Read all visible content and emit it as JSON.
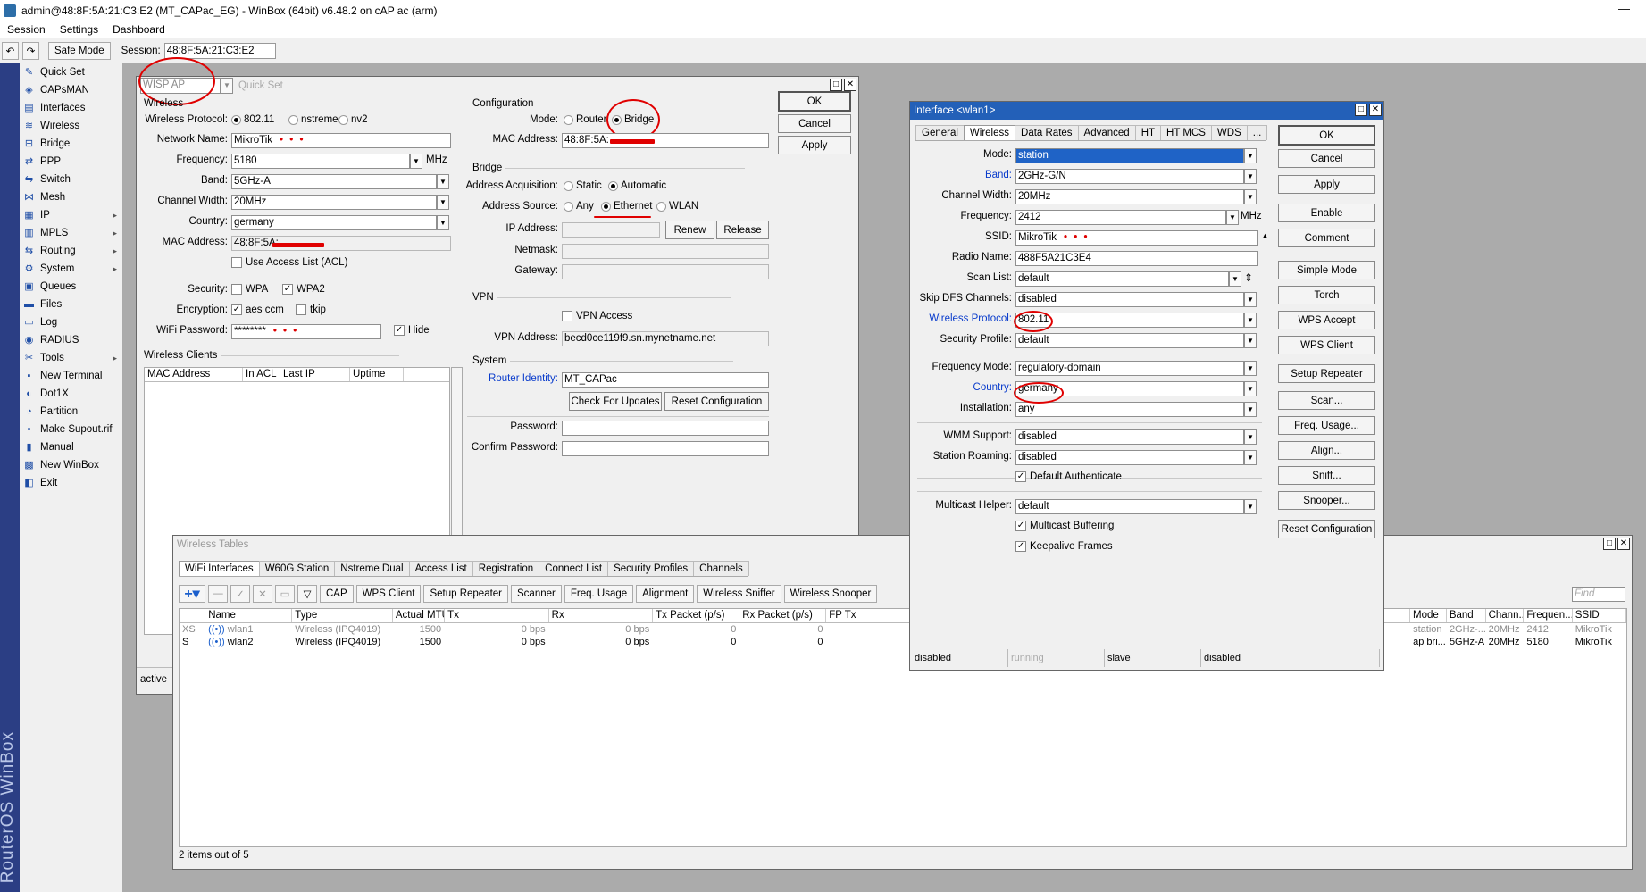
{
  "app": {
    "title": "admin@48:8F:5A:21:C3:E2 (MT_CAPac_EG) - WinBox (64bit) v6.48.2 on cAP ac (arm)",
    "minimize": "—",
    "vertical_brand": "RouterOS WinBox"
  },
  "menu": {
    "session": "Session",
    "settings": "Settings",
    "dashboard": "Dashboard"
  },
  "toolbar": {
    "undo": "↶",
    "redo": "↷",
    "safe_mode": "Safe Mode",
    "session_label": "Session:",
    "session_value": "48:8F:5A:21:C3:E2"
  },
  "sidebar": {
    "items": [
      {
        "label": "Quick Set",
        "icon": "quickset-icon"
      },
      {
        "label": "CAPsMAN",
        "icon": "capsman-icon"
      },
      {
        "label": "Interfaces",
        "icon": "interfaces-icon"
      },
      {
        "label": "Wireless",
        "icon": "wireless-icon"
      },
      {
        "label": "Bridge",
        "icon": "bridge-icon"
      },
      {
        "label": "PPP",
        "icon": "ppp-icon"
      },
      {
        "label": "Switch",
        "icon": "switch-icon"
      },
      {
        "label": "Mesh",
        "icon": "mesh-icon"
      },
      {
        "label": "IP",
        "icon": "ip-icon",
        "arrow": "▸"
      },
      {
        "label": "MPLS",
        "icon": "mpls-icon",
        "arrow": "▸"
      },
      {
        "label": "Routing",
        "icon": "routing-icon",
        "arrow": "▸"
      },
      {
        "label": "System",
        "icon": "system-icon",
        "arrow": "▸"
      },
      {
        "label": "Queues",
        "icon": "queues-icon"
      },
      {
        "label": "Files",
        "icon": "files-icon"
      },
      {
        "label": "Log",
        "icon": "log-icon"
      },
      {
        "label": "RADIUS",
        "icon": "radius-icon"
      },
      {
        "label": "Tools",
        "icon": "tools-icon",
        "arrow": "▸"
      },
      {
        "label": "New Terminal",
        "icon": "terminal-icon"
      },
      {
        "label": "Dot1X",
        "icon": "dot1x-icon"
      },
      {
        "label": "Partition",
        "icon": "partition-icon"
      },
      {
        "label": "Make Supout.rif",
        "icon": "supout-icon"
      },
      {
        "label": "Manual",
        "icon": "manual-icon"
      },
      {
        "label": "New WinBox",
        "icon": "winbox-icon"
      },
      {
        "label": "Exit",
        "icon": "exit-icon"
      }
    ]
  },
  "quickset": {
    "mode_select": "WISP AP",
    "title": "Quick Set",
    "ok": "OK",
    "cancel": "Cancel",
    "apply": "Apply",
    "wireless_section": "Wireless",
    "wireless_protocol_label": "Wireless Protocol:",
    "proto_80211": "802.11",
    "proto_nstreme": "nstreme",
    "proto_nv2": "nv2",
    "network_name_label": "Network Name:",
    "network_name": "MikroTik",
    "redacted_dots": "• • •",
    "frequency_label": "Frequency:",
    "frequency": "5180",
    "mhz": "MHz",
    "band_label": "Band:",
    "band": "5GHz-A",
    "channel_width_label": "Channel Width:",
    "channel_width": "20MHz",
    "country_label": "Country:",
    "country": "germany",
    "mac_label": "MAC Address:",
    "mac": "48:8F:5A:",
    "acl": "Use Access List (ACL)",
    "security_label": "Security:",
    "wpa": "WPA",
    "wpa2": "WPA2",
    "encryption_label": "Encryption:",
    "aes": "aes ccm",
    "tkip": "tkip",
    "wifi_password_label": "WiFi Password:",
    "wifi_password": "********",
    "hide": "Hide",
    "wireless_clients_section": "Wireless Clients",
    "clients_cols": [
      "MAC Address",
      "In ACL",
      "Last IP",
      "Uptime"
    ],
    "config_section": "Configuration",
    "mode_label": "Mode:",
    "mode_router": "Router",
    "mode_bridge": "Bridge",
    "cfg_mac_label": "MAC Address:",
    "cfg_mac": "48:8F:5A:",
    "bridge_section": "Bridge",
    "addr_acq_label": "Address Acquisition:",
    "static": "Static",
    "automatic": "Automatic",
    "addr_source_label": "Address Source:",
    "any": "Any",
    "ethernet": "Ethernet",
    "wlan": "WLAN",
    "ip_address_label": "IP Address:",
    "renew": "Renew",
    "release": "Release",
    "netmask_label": "Netmask:",
    "gateway_label": "Gateway:",
    "vpn_section": "VPN",
    "vpn_access": "VPN Access",
    "vpn_address_label": "VPN Address:",
    "vpn_address": "becd0ce119f9.sn.mynetname.net",
    "system_section": "System",
    "router_identity_label": "Router Identity:",
    "router_identity": "MT_CAPac",
    "check_updates": "Check For Updates",
    "reset_config": "Reset Configuration",
    "password_label": "Password:",
    "confirm_password_label": "Confirm Password:",
    "status": "active"
  },
  "wtables": {
    "title": "Wireless Tables",
    "tabs": [
      "WiFi Interfaces",
      "W60G Station",
      "Nstreme Dual",
      "Access List",
      "Registration",
      "Connect List",
      "Security Profiles",
      "Channels"
    ],
    "tool_buttons": [
      "CAP",
      "WPS Client",
      "Setup Repeater",
      "Scanner",
      "Freq. Usage",
      "Alignment",
      "Wireless Sniffer",
      "Wireless Snooper"
    ],
    "find_placeholder": "Find",
    "columns": [
      "Name",
      "Type",
      "Actual MTU",
      "Tx",
      "Rx",
      "Tx Packet (p/s)",
      "Rx Packet (p/s)",
      "FP Tx"
    ],
    "rows": [
      {
        "flag": "XS",
        "name": "wlan1",
        "type": "Wireless (IPQ4019)",
        "mtu": "1500",
        "tx": "0 bps",
        "rx": "0 bps",
        "txp": "0",
        "rxp": "0"
      },
      {
        "flag": "S",
        "name": "wlan2",
        "type": "Wireless (IPQ4019)",
        "mtu": "1500",
        "tx": "0 bps",
        "rx": "0 bps",
        "txp": "0",
        "rxp": "0"
      }
    ],
    "right_columns": [
      "Mode",
      "Band",
      "Chann...",
      "Frequen...",
      "SSID"
    ],
    "right_rows": [
      [
        "station",
        "2GHz-...",
        "20MHz",
        "2412",
        "MikroTik"
      ],
      [
        "ap bri...",
        "5GHz-A",
        "20MHz",
        "5180",
        "MikroTik"
      ]
    ],
    "footer": "2 items out of 5"
  },
  "iface": {
    "title": "Interface <wlan1>",
    "tabs": [
      "General",
      "Wireless",
      "Data Rates",
      "Advanced",
      "HT",
      "HT MCS",
      "WDS",
      "..."
    ],
    "fields": {
      "mode_label": "Mode:",
      "mode": "station",
      "band_label": "Band:",
      "band": "2GHz-G/N",
      "cw_label": "Channel Width:",
      "cw": "20MHz",
      "freq_label": "Frequency:",
      "freq": "2412",
      "mhz": "MHz",
      "ssid_label": "SSID:",
      "ssid": "MikroTik",
      "radio_label": "Radio Name:",
      "radio": "488F5A21C3E4",
      "scan_label": "Scan List:",
      "scan": "default",
      "skipdfs_label": "Skip DFS Channels:",
      "skipdfs": "disabled",
      "wproto_label": "Wireless Protocol:",
      "wproto": "802.11",
      "secprof_label": "Security Profile:",
      "secprof": "default",
      "freqmode_label": "Frequency Mode:",
      "freqmode": "regulatory-domain",
      "country_label": "Country:",
      "country": "germany",
      "install_label": "Installation:",
      "install": "any",
      "wmm_label": "WMM Support:",
      "wmm": "disabled",
      "roam_label": "Station Roaming:",
      "roam": "disabled",
      "defauth": "Default Authenticate",
      "mcast_label": "Multicast Helper:",
      "mcast": "default",
      "mcast_buf": "Multicast Buffering",
      "keepalive": "Keepalive Frames"
    },
    "buttons": [
      "OK",
      "Cancel",
      "Apply",
      "Enable",
      "Comment",
      "Simple Mode",
      "Torch",
      "WPS Accept",
      "WPS Client",
      "Setup Repeater",
      "Scan...",
      "Freq. Usage...",
      "Align...",
      "Sniff...",
      "Snooper...",
      "Reset Configuration"
    ],
    "status": [
      "disabled",
      "running",
      "slave",
      "disabled"
    ]
  },
  "colors": {
    "accent_blue": "#0a3ccc",
    "annotation_red": "#e00000",
    "sidebar_blue": "#2b3e84"
  }
}
